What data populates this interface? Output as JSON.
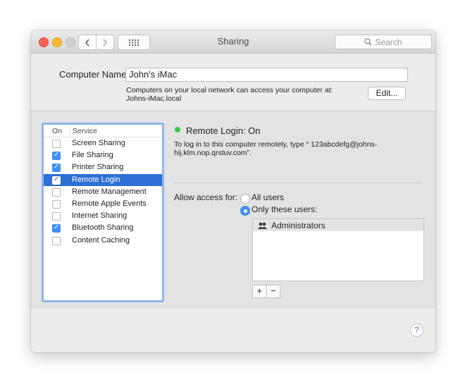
{
  "window": {
    "title": "Sharing",
    "search_placeholder": "Search",
    "nav": {
      "back_icon": "chevron-left-icon",
      "forward_icon": "chevron-right-icon",
      "grid_icon": "grid-icon"
    }
  },
  "computer": {
    "name_label": "Computer Name:",
    "name_value": "John's iMac",
    "info_line1": "Computers on your local network can access your computer at:",
    "info_line2": "Johns-iMac.local",
    "edit_label": "Edit..."
  },
  "services": {
    "header_on": "On",
    "header_service": "Service",
    "items": [
      {
        "label": "Screen Sharing",
        "on": false,
        "selected": false
      },
      {
        "label": "File Sharing",
        "on": true,
        "selected": false
      },
      {
        "label": "Printer Sharing",
        "on": true,
        "selected": false
      },
      {
        "label": "Remote Login",
        "on": true,
        "selected": true
      },
      {
        "label": "Remote Management",
        "on": false,
        "selected": false
      },
      {
        "label": "Remote Apple Events",
        "on": false,
        "selected": false
      },
      {
        "label": "Internet Sharing",
        "on": false,
        "selected": false
      },
      {
        "label": "Bluetooth Sharing",
        "on": true,
        "selected": false
      },
      {
        "label": "Content Caching",
        "on": false,
        "selected": false
      }
    ]
  },
  "detail": {
    "status": "Remote Login: On",
    "status_color": "#3ec44a",
    "info_line1": "To log in to this computer remotely, type “ 123abcdefg@johns-",
    "info_line2": "hij.klm.nop.qrstuv.com”.",
    "allow_label": "Allow access for:",
    "radio_all": "All users",
    "radio_only": "Only these users:",
    "selected_radio": "only",
    "users": [
      {
        "name": "Administrators",
        "icon": "group-icon"
      }
    ],
    "add_label": "+",
    "remove_label": "−"
  },
  "help": {
    "label": "?"
  },
  "colors": {
    "accent": "#3f8ff5",
    "selection": "#2d6fd6",
    "list_focus_ring": "#8bb6ec"
  }
}
